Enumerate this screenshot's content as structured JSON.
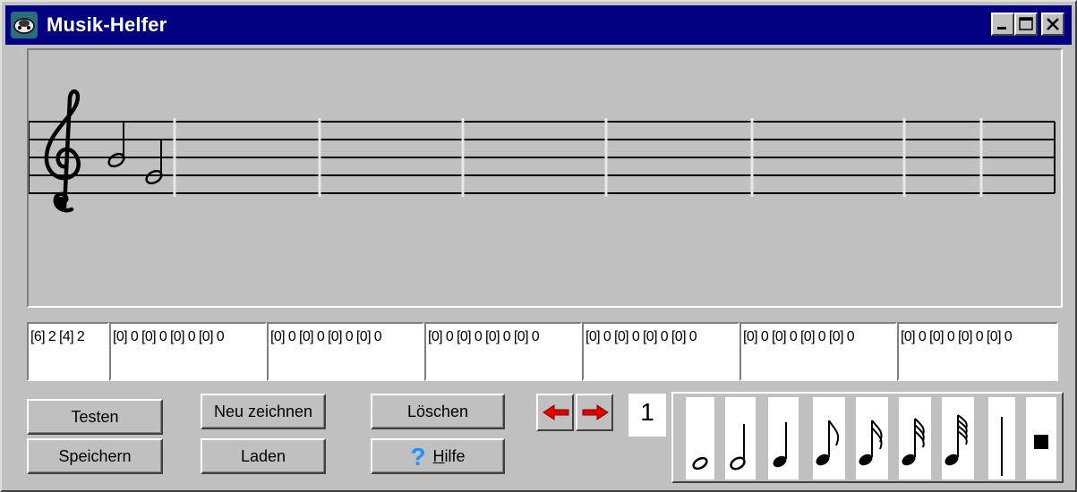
{
  "window": {
    "title": "Musik-Helfer",
    "controls": [
      "minimize",
      "maximize",
      "close"
    ]
  },
  "staff": {
    "clef": "treble-clef",
    "notes": [
      "half-note",
      "half-note"
    ]
  },
  "codes": [
    "[6] 2 [4] 2",
    "[0] 0 [0] 0 [0] 0 [0] 0",
    "[0] 0 [0] 0 [0] 0 [0] 0",
    "[0] 0 [0] 0 [0] 0 [0] 0",
    "[0] 0 [0] 0 [0] 0 [0] 0",
    "[0] 0 [0] 0 [0] 0 [0] 0",
    "[0] 0 [0] 0 [0] 0 [0] 0"
  ],
  "buttons": {
    "testen": "Testen",
    "speichern": "Speichern",
    "neu_zeichnen": "Neu zeichnen",
    "laden": "Laden",
    "loeschen": "Löschen",
    "hilfe_h": "H",
    "hilfe_rest": "ilfe"
  },
  "navigation": {
    "page": "1",
    "prev_icon": "arrow-left-icon",
    "next_icon": "arrow-right-icon"
  },
  "palette": [
    "whole-note",
    "half-note",
    "quarter-note",
    "eighth-note",
    "sixteenth-note",
    "thirty-second-note",
    "sixty-fourth-note",
    "bar-line",
    "rest-block"
  ],
  "colors": {
    "titlebar": "#000080",
    "face": "#c0c0c0",
    "arrow": "#e00000",
    "help": "#1e90ff"
  }
}
